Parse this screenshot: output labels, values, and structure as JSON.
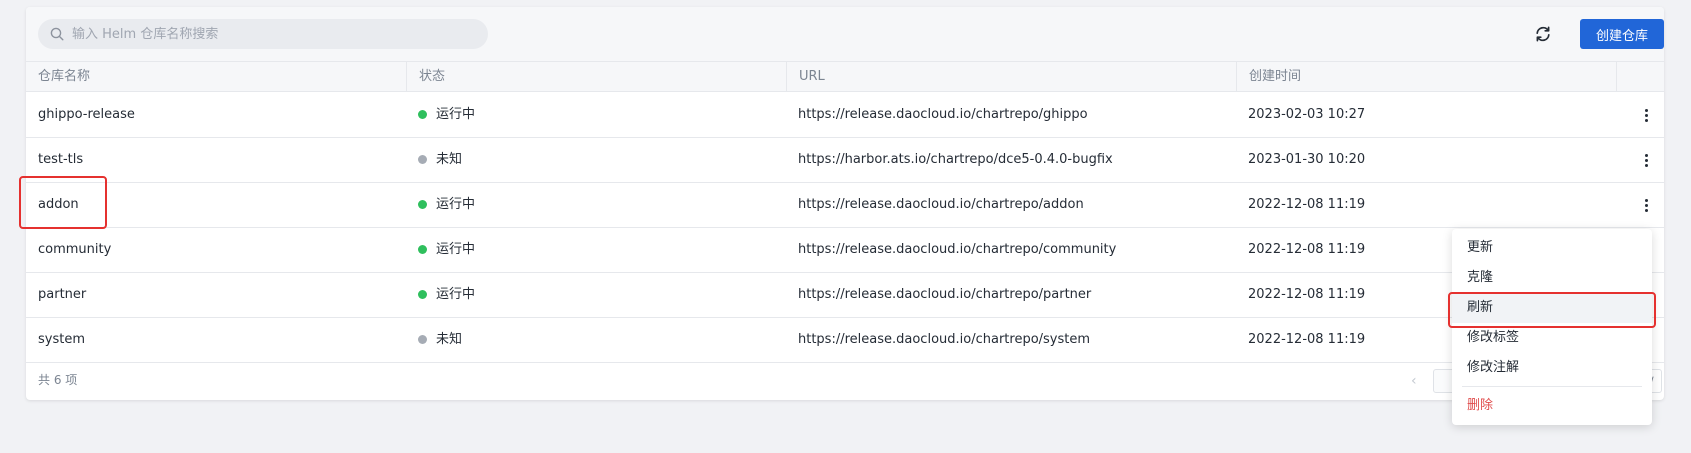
{
  "toolbar": {
    "search_placeholder": "输入 Helm 仓库名称搜索",
    "refresh_icon": "refresh-icon",
    "create_label": "创建仓库"
  },
  "table": {
    "columns": [
      "仓库名称",
      "状态",
      "URL",
      "创建时间"
    ],
    "rows": [
      {
        "name": "ghippo-release",
        "status": "运行中",
        "status_color": "#2fbf5d",
        "url": "https://release.daocloud.io/chartrepo/ghippo",
        "created": "2023-02-03 10:27"
      },
      {
        "name": "test-tls",
        "status": "未知",
        "status_color": "#a6acb5",
        "url": "https://harbor.ats.io/chartrepo/dce5-0.4.0-bugfix",
        "created": "2023-01-30 10:20"
      },
      {
        "name": "addon",
        "status": "运行中",
        "status_color": "#2fbf5d",
        "url": "https://release.daocloud.io/chartrepo/addon",
        "created": "2022-12-08 11:19"
      },
      {
        "name": "community",
        "status": "运行中",
        "status_color": "#2fbf5d",
        "url": "https://release.daocloud.io/chartrepo/community",
        "created": "2022-12-08 11:19"
      },
      {
        "name": "partner",
        "status": "运行中",
        "status_color": "#2fbf5d",
        "url": "https://release.daocloud.io/chartrepo/partner",
        "created": "2022-12-08 11:19"
      },
      {
        "name": "system",
        "status": "未知",
        "status_color": "#a6acb5",
        "url": "https://release.daocloud.io/chartrepo/system",
        "created": "2022-12-08 11:19"
      }
    ]
  },
  "footer": {
    "total": "共 6 项"
  },
  "menu": {
    "items": [
      "更新",
      "克隆",
      "刷新",
      "修改标签",
      "修改注解"
    ],
    "danger_item": "删除"
  },
  "colors": {
    "accent": "#2166d8",
    "highlight": "#e5312f"
  }
}
